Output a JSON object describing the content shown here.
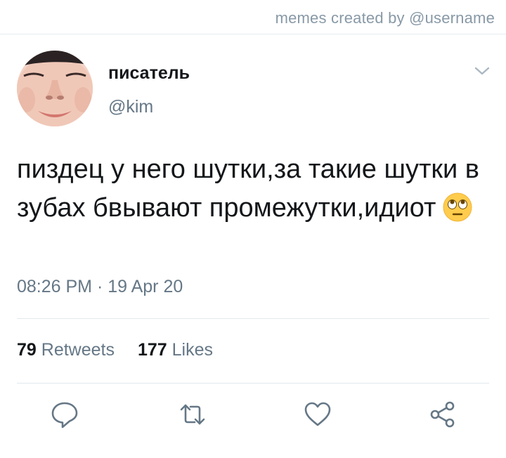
{
  "watermark": "memes created by @username",
  "tweet": {
    "display_name": "писатель",
    "handle": "@kim",
    "text": "пиздец у него шутки,за такие шутки в зубах бвывают промежутки,идиот",
    "emoji": "face-with-rolling-eyes",
    "timestamp": "08:26 PM · 19 Apr 20"
  },
  "stats": {
    "retweets_count": "79",
    "retweets_label": "Retweets",
    "likes_count": "177",
    "likes_label": "Likes"
  },
  "actions": [
    {
      "name": "reply",
      "icon": "speech-bubble-icon"
    },
    {
      "name": "retweet",
      "icon": "retweet-icon"
    },
    {
      "name": "like",
      "icon": "heart-icon"
    },
    {
      "name": "share",
      "icon": "share-icon"
    }
  ],
  "colors": {
    "text_primary": "#14171a",
    "text_secondary": "#657786",
    "divider": "#e1e8ed",
    "icon": "#657786"
  }
}
